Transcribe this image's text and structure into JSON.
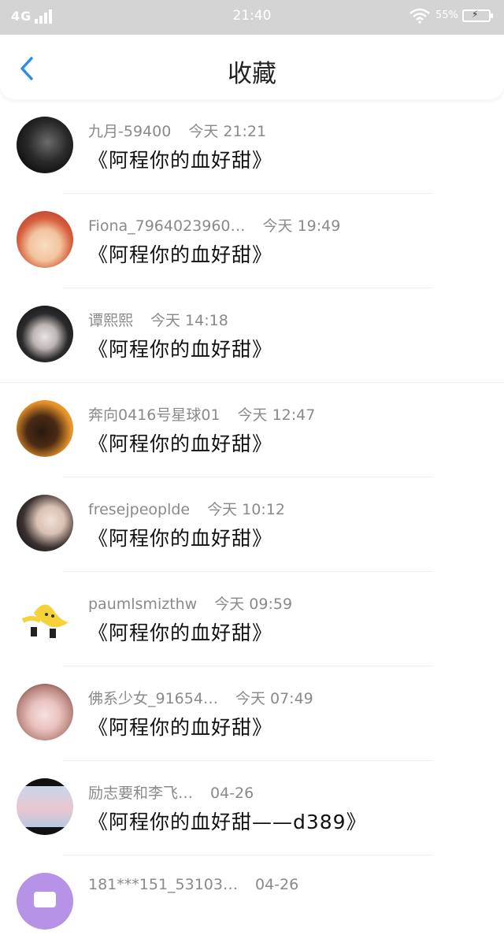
{
  "status_bar": {
    "network": "4G",
    "time": "21:40",
    "battery_percent": "55%"
  },
  "header": {
    "title": "收藏",
    "back_icon": "chevron-left-icon",
    "accent_color": "#2d8ee6"
  },
  "items": [
    {
      "user": "九月-59400",
      "time": "今天  21:21",
      "title": "《阿程你的血好甜》"
    },
    {
      "user": "Fiona_7964023960…",
      "time": "今天  19:49",
      "title": "《阿程你的血好甜》"
    },
    {
      "user": "谭熙熙",
      "time": "今天  14:18",
      "title": "《阿程你的血好甜》"
    },
    {
      "user": "奔向0416号星球01",
      "time": "今天  12:47",
      "title": "《阿程你的血好甜》"
    },
    {
      "user": "fresejpeoplde",
      "time": "今天  10:12",
      "title": "《阿程你的血好甜》"
    },
    {
      "user": "paumlsmizthw",
      "time": "今天  09:59",
      "title": "《阿程你的血好甜》"
    },
    {
      "user": "佛系少女_91654…",
      "time": "今天  07:49",
      "title": "《阿程你的血好甜》"
    },
    {
      "user": "励志要和李飞…",
      "time": "04-26",
      "title": "《阿程你的血好甜——d389》"
    },
    {
      "user": "181***151_53103…",
      "time": "04-26",
      "title": ""
    }
  ]
}
